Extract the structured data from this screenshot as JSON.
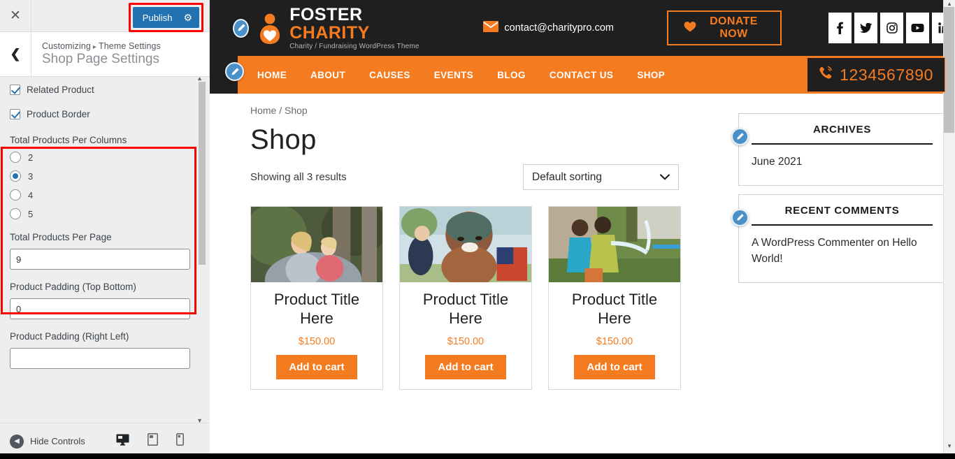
{
  "customizer": {
    "close_icon": "close-icon",
    "publish_label": "Publish",
    "publish_gear": "gear-icon",
    "back_icon": "chevron-left-icon",
    "breadcrumb_root": "Customizing",
    "breadcrumb_sep": "▸",
    "breadcrumb_parent": "Theme Settings",
    "page_title": "Shop Page Settings",
    "checkboxes": [
      {
        "label": "Related Product",
        "checked": true
      },
      {
        "label": "Product Border",
        "checked": true
      }
    ],
    "columns_label": "Total Products Per Columns",
    "columns_options": [
      {
        "label": "2",
        "selected": false
      },
      {
        "label": "3",
        "selected": true
      },
      {
        "label": "4",
        "selected": false
      },
      {
        "label": "5",
        "selected": false
      }
    ],
    "per_page_label": "Total Products Per Page",
    "per_page_value": "9",
    "padding_tb_label": "Product Padding (Top Bottom)",
    "padding_tb_value": "0",
    "padding_rl_label": "Product Padding (Right Left)",
    "padding_rl_value": "",
    "hide_controls_label": "Hide Controls",
    "devices": [
      {
        "name": "desktop-view",
        "active": true
      },
      {
        "name": "tablet-view",
        "active": false
      },
      {
        "name": "mobile-view",
        "active": false
      }
    ],
    "highlight_color": "#ff0000",
    "accent_color": "#2271b1"
  },
  "site": {
    "brand": {
      "name_part1": "FOSTER",
      "name_part2": "CHARITY",
      "tagline": "Charity / Fundraising WordPress Theme"
    },
    "email": "contact@charitypro.com",
    "donate_label": "DONATE NOW",
    "socials": [
      "facebook-icon",
      "twitter-icon",
      "instagram-icon",
      "youtube-icon",
      "linkedin-icon"
    ],
    "nav": [
      "HOME",
      "ABOUT",
      "CAUSES",
      "EVENTS",
      "BLOG",
      "CONTACT US",
      "SHOP"
    ],
    "search_icon": "search-icon",
    "phone": "1234567890",
    "accent_color": "#f47b20",
    "dark_color": "#1f1f1f"
  },
  "shop": {
    "breadcrumb": "Home / Shop",
    "title": "Shop",
    "results_text": "Showing all 3 results",
    "sorting_selected": "Default sorting",
    "products": [
      {
        "title": "Product Title Here",
        "price": "$150.00",
        "button": "Add to cart",
        "image": "mother-and-baby-photo"
      },
      {
        "title": "Product Title Here",
        "price": "$150.00",
        "button": "Add to cart",
        "image": "smiling-boy-photo"
      },
      {
        "title": "Product Title Here",
        "price": "$150.00",
        "button": "Add to cart",
        "image": "children-water-photo"
      }
    ]
  },
  "sidebar": {
    "widgets": [
      {
        "title": "ARCHIVES",
        "items": [
          "June 2021"
        ]
      },
      {
        "title": "RECENT COMMENTS",
        "items": [
          "A WordPress Commenter on Hello World!"
        ]
      }
    ]
  }
}
